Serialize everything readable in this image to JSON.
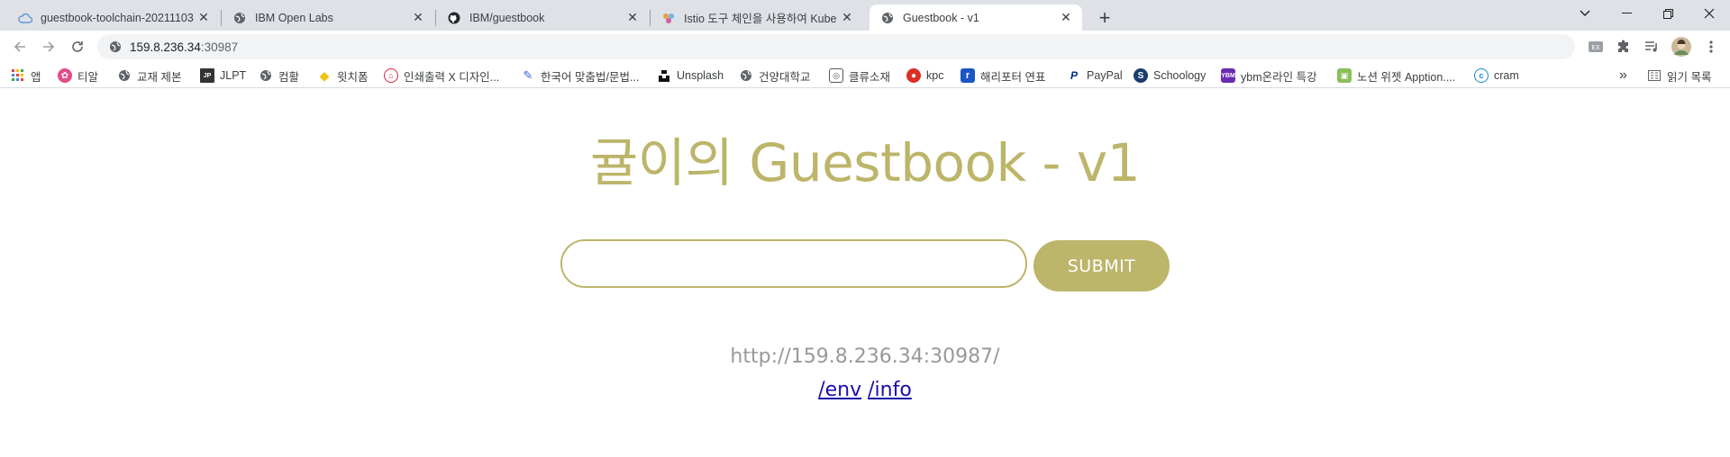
{
  "browser": {
    "tabs": [
      {
        "title": "guestbook-toolchain-20211103",
        "icon": "cloud-icon"
      },
      {
        "title": "IBM Open Labs",
        "icon": "globe-icon"
      },
      {
        "title": "IBM/guestbook",
        "icon": "github-icon"
      },
      {
        "title": "Istio 도구 체인을 사용하여 Kube",
        "icon": "istio-icon"
      },
      {
        "title": "Guestbook - v1",
        "icon": "globe-icon"
      }
    ],
    "active_tab": 4,
    "new_tab_label": "+",
    "url_host": "159.8.236.34",
    "url_port": ":30987",
    "bookmarks": [
      {
        "label": "앱"
      },
      {
        "label": "티알"
      },
      {
        "label": "교재 제본"
      },
      {
        "label": "JLPT"
      },
      {
        "label": "컴활"
      },
      {
        "label": "윗치폼"
      },
      {
        "label": "인쇄출력 X 디자인..."
      },
      {
        "label": "한국어 맞춤법/문법..."
      },
      {
        "label": "Unsplash"
      },
      {
        "label": "건양대학교"
      },
      {
        "label": "클류소재"
      },
      {
        "label": "kpc"
      },
      {
        "label": "해리포터 연표"
      },
      {
        "label": "PayPal"
      },
      {
        "label": "Schoology"
      },
      {
        "label": "ybm온라인 특강"
      },
      {
        "label": "노션 위젯 Apption...."
      },
      {
        "label": "cram"
      }
    ],
    "bookmarks_overflow": "»",
    "reading_list_label": "읽기 목록"
  },
  "page": {
    "title": "귤이의 Guestbook - v1",
    "entry_value": "",
    "submit_label": "SUBMIT",
    "address": "http://159.8.236.34:30987/",
    "link_env": "/env",
    "link_info": "/info"
  },
  "colors": {
    "accent": "#bcb56a",
    "tabstrip_bg": "#dee1e6",
    "address_text": "#999999",
    "link": "#1a0dab"
  }
}
